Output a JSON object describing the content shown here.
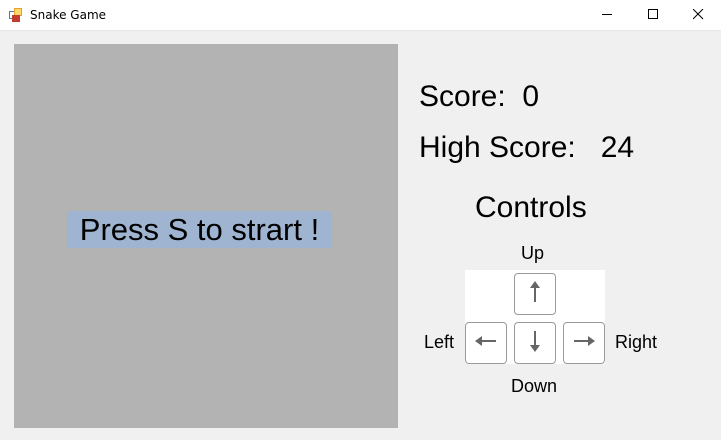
{
  "window": {
    "title": "Snake Game",
    "icon": "app-icon",
    "controls": [
      "minimize-icon",
      "maximize-icon",
      "close-icon"
    ]
  },
  "board": {
    "start_message": "Press S to strart !",
    "background": "#b3b3b3",
    "message_background": "#9fb4d0"
  },
  "scores": {
    "score_text": "Score:  0",
    "high_score_text": "High Score:   24"
  },
  "controls": {
    "title": "Controls",
    "up_label": "Up",
    "down_label": "Down",
    "left_label": "Left",
    "right_label": "Right",
    "keys": [
      "arrow-up-icon",
      "arrow-left-icon",
      "arrow-down-icon",
      "arrow-right-icon"
    ]
  }
}
